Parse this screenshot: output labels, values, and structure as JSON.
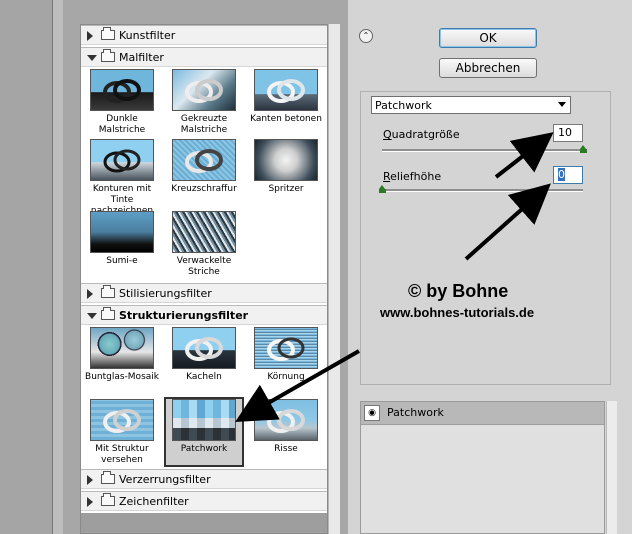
{
  "gallery": {
    "categories": {
      "kunstfilter": "Kunstfilter",
      "malfilter": "Malfilter",
      "stilisierungsfilter": "Stilisierungsfilter",
      "strukturierungsfilter": "Strukturierungsfilter",
      "verzerrungsfilter": "Verzerrungsfilter",
      "zeichenfilter": "Zeichenfilter"
    },
    "malfilter_items": [
      "Dunkle Malstriche",
      "Gekreuzte Malstriche",
      "Kanten betonen",
      "Konturen mit Tinte nachzeichnen",
      "Kreuzschraffur",
      "Spritzer",
      "Sumi-e",
      "Verwackelte Striche"
    ],
    "struktur_items": [
      "Buntglas-Mosaik",
      "Kacheln",
      "Körnung",
      "Mit Struktur versehen",
      "Patchwork",
      "Risse"
    ],
    "selected": "Patchwork"
  },
  "buttons": {
    "ok": "OK",
    "cancel": "Abbrechen",
    "collapse": "⌃"
  },
  "settings": {
    "filter_select": "Patchwork",
    "param1": {
      "label": "Quadratgröße",
      "value": "10",
      "level": 1.0
    },
    "param2": {
      "label": "Reliefhöhe",
      "value": "0",
      "level": 0.0
    }
  },
  "layers": {
    "row1_name": "Patchwork"
  },
  "watermark": {
    "line1": "© by Bohne",
    "line2": "www.bohnes-tutorials.de"
  },
  "colors": {
    "arrow": "#000000",
    "slider_knob": "#2d7a24",
    "selection_highlight": "#3370c4"
  }
}
